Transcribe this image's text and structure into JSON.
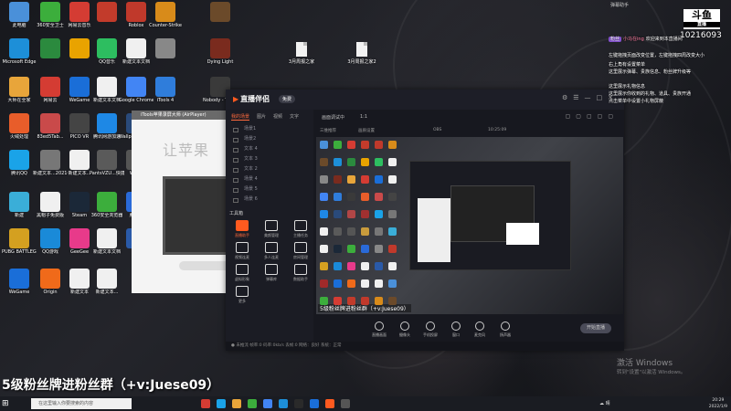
{
  "desktop": {
    "icons": [
      {
        "label": "此电脑",
        "color": "#4a90d9"
      },
      {
        "label": "360安全卫士",
        "color": "#3cae3c"
      },
      {
        "label": "网易云音乐",
        "color": "#d43c33"
      },
      {
        "label": "",
        "color": "#c23b2b"
      },
      {
        "label": "Roblox",
        "color": "#c0392b"
      },
      {
        "label": "Counter-Strike",
        "color": "#d88b1a"
      },
      {
        "label": "",
        "color": "#6b4a2a"
      },
      {
        "label": "Microsoft Edge",
        "color": "#1d8fd8"
      },
      {
        "label": "",
        "color": "#2b8a3e"
      },
      {
        "label": "",
        "color": "#e9a300"
      },
      {
        "label": "QQ音乐",
        "color": "#2dbe60"
      },
      {
        "label": "新建文本文档",
        "color": "#f0f0f0"
      },
      {
        "label": "",
        "color": "#888"
      },
      {
        "label": "Dying Light",
        "color": "#7a2b1e"
      },
      {
        "label": "大师在全家",
        "color": "#e8a53a"
      },
      {
        "label": "网易云",
        "color": "#d43c33"
      },
      {
        "label": "WeGame",
        "color": "#1a6ed8"
      },
      {
        "label": "新建文本文档",
        "color": "#f0f0f0"
      },
      {
        "label": "Google Chrome",
        "color": "#4285f4"
      },
      {
        "label": "iTools 4",
        "color": "#2f7ddb"
      },
      {
        "label": "Nobody - The Turnaround",
        "color": "#3a3a3a"
      },
      {
        "label": "火绒处理",
        "color": "#e85d2a"
      },
      {
        "label": "83ed5Tab...",
        "color": "#c94a4a"
      },
      {
        "label": "PICO VR",
        "color": "#444"
      },
      {
        "label": "腾讯网游加速",
        "color": "#1e88e5"
      },
      {
        "label": "Wallpaper Engine",
        "color": "#2a4a7a"
      },
      {
        "label": "8f766ab7...",
        "color": "#b04646"
      },
      {
        "label": "Grand Dragon",
        "color": "#a03030"
      },
      {
        "label": "腾讯QQ",
        "color": "#1aa3e8"
      },
      {
        "label": "新建文本...2021090...",
        "color": "#777"
      },
      {
        "label": "新建文本...",
        "color": "#f0f0f0"
      },
      {
        "label": "PantsVZU...快捷方式",
        "color": "#5a5a5a"
      },
      {
        "label": "WAI...",
        "color": "#555"
      },
      {
        "label": "LeagueOf Legends",
        "color": "#c89b3c"
      },
      {
        "label": "新建文本...2021090...",
        "color": "#777"
      },
      {
        "label": "新建",
        "color": "#3aaed8"
      },
      {
        "label": "黑帽子免费版",
        "color": "#f0f0f0"
      },
      {
        "label": "Steam",
        "color": "#1b2838"
      },
      {
        "label": "360安全浏览器",
        "color": "#3cae3c"
      },
      {
        "label": "腾讯...",
        "color": "#2a6ad8"
      },
      {
        "label": "WeRiché...",
        "color": "#888"
      },
      {
        "label": "Among Us",
        "color": "#c0392b"
      },
      {
        "label": "PUBG BATTLEGR...",
        "color": "#d4a020"
      },
      {
        "label": "QQ游戏",
        "color": "#1a8ad8"
      },
      {
        "label": "GeeGee",
        "color": "#e83a8a"
      },
      {
        "label": "新建文本文档",
        "color": "#f0f0f0"
      },
      {
        "label": "PS",
        "color": "#2a5aa8"
      },
      {
        "label": "新建文本",
        "color": "#f0f0f0"
      },
      {
        "label": "荒野大镖客",
        "color": "#a02a2a"
      },
      {
        "label": "WeGame",
        "color": "#1a6ed8"
      },
      {
        "label": "Origin",
        "color": "#f06a1a"
      },
      {
        "label": "新建文本",
        "color": "#f0f0f0"
      },
      {
        "label": "新建文本...",
        "color": "#f0f0f0"
      }
    ],
    "files": [
      {
        "label": "3月周报之家"
      },
      {
        "label": "3月周报之家2"
      }
    ]
  },
  "itools": {
    "title": "iTools苹果录屏大师 (AirPlayer)",
    "big_text": "让苹果"
  },
  "app": {
    "name": "直播伴侣",
    "version": "免费",
    "left_tabs": [
      "我的场景",
      "图片",
      "视频",
      "文字"
    ],
    "scenes": [
      "场景1",
      "场景2",
      "文本 4",
      "文本 3",
      "文本 2",
      "场景 4",
      "场景 5",
      "场景 6"
    ],
    "tools_title": "工具箱",
    "tools": [
      {
        "label": "直播助手",
        "hot": true
      },
      {
        "label": "美颜管理",
        "hot": false
      },
      {
        "label": "主播任务",
        "hot": false
      },
      {
        "label": "视频连麦",
        "hot": false
      },
      {
        "label": "多人连麦",
        "hot": false
      },
      {
        "label": "房间管理",
        "hot": false
      },
      {
        "label": "虚拟形象",
        "hot": false
      },
      {
        "label": "弹幕库",
        "hot": false
      },
      {
        "label": "数据助手",
        "hot": false
      },
      {
        "label": "更多",
        "hot": false
      }
    ],
    "header_left": "画面调试中",
    "header_mid": "1:1",
    "sub_labels": [
      "三维推荐",
      "画质设置",
      "OBS",
      "10:25:09"
    ],
    "preview_caption": "5级粉丝牌进粉丝群（+v:Juese09）",
    "bar_buttons": [
      "直播画面",
      "摄像头",
      "手机投屏",
      "窗口",
      "麦克风",
      "扬声器"
    ],
    "go_live": "开始直播",
    "status": "● 未推流  帧率:0  码率:0kb/s  丢帧:0  网络：良好  系统：正常"
  },
  "chat": {
    "top": "弹幕助手",
    "room_badge": "斗鱼",
    "room_badge_sub": "直播",
    "room_id": "10216093",
    "messages": [
      {
        "badge": "粉丝",
        "nick": "小马在ing",
        "text": "欢迎来到本直播间"
      },
      {
        "badge": "",
        "nick": "",
        "text": "左键拖拽页面改变位置，左键拖拽四周改变大小"
      },
      {
        "badge": "",
        "nick": "",
        "text": "右上角有设置菜单"
      },
      {
        "badge": "",
        "nick": "",
        "text": "这里展示弹幕、贵族信息、粉丝牌升级等"
      },
      {
        "badge": "",
        "nick": "",
        "text": "这里展示礼物信息"
      },
      {
        "badge": "",
        "nick": "",
        "text": "这里展示你收到的礼物、道具、贵族开通"
      },
      {
        "badge": "",
        "nick": "",
        "text": "点击菜单中设置小礼物屏蔽"
      }
    ]
  },
  "overlay": {
    "caption": "5级粉丝牌进粉丝群（+v:Juese09）",
    "activate_title": "激活 Windows",
    "activate_sub": "转到\"设置\"以激活 Windows。"
  },
  "taskbar": {
    "start": "⊞",
    "search_placeholder": "在这里输入你要搜索的内容",
    "apps": [
      "#d43c33",
      "#1aa3e8",
      "#e8a53a",
      "#3cae3c",
      "#4285f4",
      "#1d8fd8",
      "#2a2a2a",
      "#1a6ed8",
      "#ff5a1f",
      "#555"
    ],
    "weather": "☁ 晴",
    "time": "20:29",
    "date": "2022/1/9"
  }
}
